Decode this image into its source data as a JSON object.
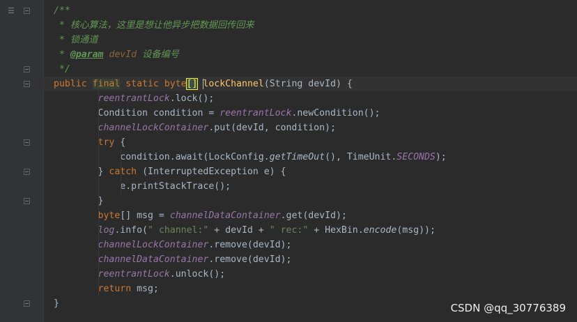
{
  "lines": [
    {
      "indent": "",
      "tokens": [
        {
          "t": "/**",
          "c": "c-doc"
        }
      ]
    },
    {
      "indent": " ",
      "tokens": [
        {
          "t": "* 核心算法，这里是想让他异步把数据回传回来",
          "c": "c-doc"
        }
      ]
    },
    {
      "indent": " ",
      "tokens": [
        {
          "t": "* 锁通道",
          "c": "c-doc"
        }
      ]
    },
    {
      "indent": " ",
      "tokens": [
        {
          "t": "* ",
          "c": "c-doc"
        },
        {
          "t": "@param",
          "c": "c-tag"
        },
        {
          "t": " devId ",
          "c": "c-param"
        },
        {
          "t": "设备编号",
          "c": "c-doc"
        }
      ]
    },
    {
      "indent": " ",
      "tokens": [
        {
          "t": "*/",
          "c": "c-doc"
        }
      ]
    },
    {
      "indent": "",
      "tokens": [
        {
          "t": "public ",
          "c": "kw"
        },
        {
          "t": "final",
          "c": "kw final-hl"
        },
        {
          "t": " static ",
          "c": "kw"
        },
        {
          "t": "byte",
          "c": "kw"
        },
        {
          "t": "[]",
          "c": "brk"
        },
        {
          "t": " ",
          "c": ""
        },
        {
          "t": "|",
          "c": "caret"
        },
        {
          "t": "lockChannel",
          "c": "fn"
        },
        {
          "t": "(String devId) {",
          "c": ""
        }
      ]
    },
    {
      "indent": "        ",
      "tokens": [
        {
          "t": "reentrantLock",
          "c": "field"
        },
        {
          "t": ".lock();",
          "c": ""
        }
      ]
    },
    {
      "indent": "        ",
      "tokens": [
        {
          "t": "Condition condition = ",
          "c": ""
        },
        {
          "t": "reentrantLock",
          "c": "field"
        },
        {
          "t": ".newCondition();",
          "c": ""
        }
      ]
    },
    {
      "indent": "        ",
      "tokens": [
        {
          "t": "channelLockContainer",
          "c": "field"
        },
        {
          "t": ".put(devId, condition);",
          "c": ""
        }
      ]
    },
    {
      "indent": "        ",
      "tokens": [
        {
          "t": "try",
          "c": "kw"
        },
        {
          "t": " {",
          "c": ""
        }
      ]
    },
    {
      "indent": "            ",
      "tokens": [
        {
          "t": "condition.await(LockConfig.",
          "c": ""
        },
        {
          "t": "getTimeOut",
          "c": "sm"
        },
        {
          "t": "(), TimeUnit.",
          "c": ""
        },
        {
          "t": "SECONDS",
          "c": "const"
        },
        {
          "t": ");",
          "c": ""
        }
      ]
    },
    {
      "indent": "        ",
      "tokens": [
        {
          "t": "} ",
          "c": ""
        },
        {
          "t": "catch",
          "c": "kw"
        },
        {
          "t": " (InterruptedException e) {",
          "c": ""
        }
      ]
    },
    {
      "indent": "            ",
      "tokens": [
        {
          "t": "e.printStackTrace();",
          "c": ""
        }
      ]
    },
    {
      "indent": "        ",
      "tokens": [
        {
          "t": "}",
          "c": ""
        }
      ]
    },
    {
      "indent": "        ",
      "tokens": [
        {
          "t": "byte",
          "c": "kw"
        },
        {
          "t": "[] msg = ",
          "c": ""
        },
        {
          "t": "channelDataContainer",
          "c": "field"
        },
        {
          "t": ".get(devId);",
          "c": ""
        }
      ]
    },
    {
      "indent": "        ",
      "tokens": [
        {
          "t": "log",
          "c": "field"
        },
        {
          "t": ".info(",
          "c": ""
        },
        {
          "t": "\" channel:\"",
          "c": "str"
        },
        {
          "t": " + devId + ",
          "c": ""
        },
        {
          "t": "\" rec:\"",
          "c": "str"
        },
        {
          "t": " + HexBin.",
          "c": ""
        },
        {
          "t": "encode",
          "c": "sm"
        },
        {
          "t": "(msg));",
          "c": ""
        }
      ]
    },
    {
      "indent": "        ",
      "tokens": [
        {
          "t": "channelLockContainer",
          "c": "field"
        },
        {
          "t": ".remove(devId);",
          "c": ""
        }
      ]
    },
    {
      "indent": "        ",
      "tokens": [
        {
          "t": "channelDataContainer",
          "c": "field"
        },
        {
          "t": ".remove(devId);",
          "c": ""
        }
      ]
    },
    {
      "indent": "        ",
      "tokens": [
        {
          "t": "reentrantLock",
          "c": "field"
        },
        {
          "t": ".unlock();",
          "c": ""
        }
      ]
    },
    {
      "indent": "        ",
      "tokens": [
        {
          "t": "return",
          "c": "kw"
        },
        {
          "t": " msg;",
          "c": ""
        }
      ]
    },
    {
      "indent": "",
      "tokens": [
        {
          "t": "}",
          "c": ""
        }
      ]
    }
  ],
  "watermark": "CSDN @qq_30776389",
  "colors": {
    "background": "#2b2b2b",
    "gutter": "#313335",
    "keyword": "#cc7832",
    "comment": "#629755",
    "field": "#9876aa",
    "method_decl": "#ffc66d",
    "string": "#6a8759",
    "text": "#a9b7c6"
  },
  "icons": {
    "structure": "structure-icon",
    "fold": "fold-marker-icon"
  }
}
